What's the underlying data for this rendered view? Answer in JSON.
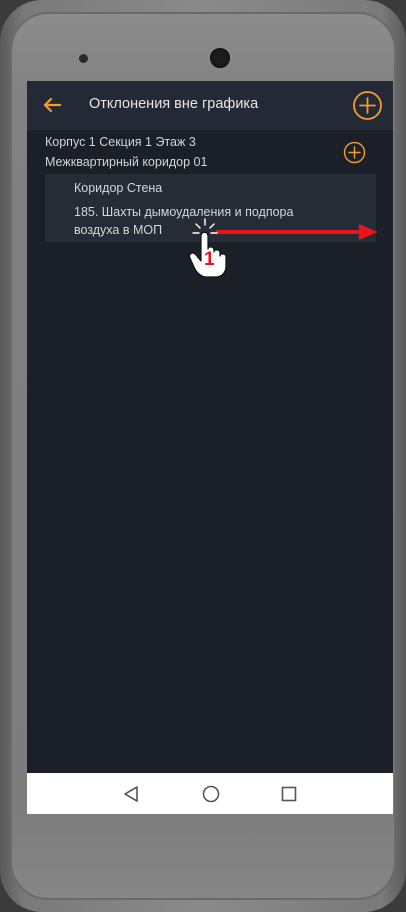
{
  "header": {
    "title": "Отклонения вне графика"
  },
  "group": {
    "line1": "Корпус 1 Секция 1 Этаж 3",
    "line2": "Межквартирный коридор 01"
  },
  "item": {
    "title": "Коридор Стена",
    "description": "185. Шахты дымоудаления и подпора воздуха в МОП"
  },
  "gesture": {
    "step_number": "1",
    "action": "swipe-right"
  },
  "colors": {
    "accent": "#f39c33",
    "screen_bg": "#1b1f27",
    "appbar_bg": "#242a35",
    "card_bg": "#262c36",
    "arrow": "#e8141b"
  },
  "icons": {
    "back": "arrow-left-icon",
    "add": "plus-circle-icon",
    "nav_back": "triangle-back-icon",
    "nav_home": "circle-home-icon",
    "nav_recent": "square-recent-icon",
    "hand": "hand-pointer-icon"
  }
}
